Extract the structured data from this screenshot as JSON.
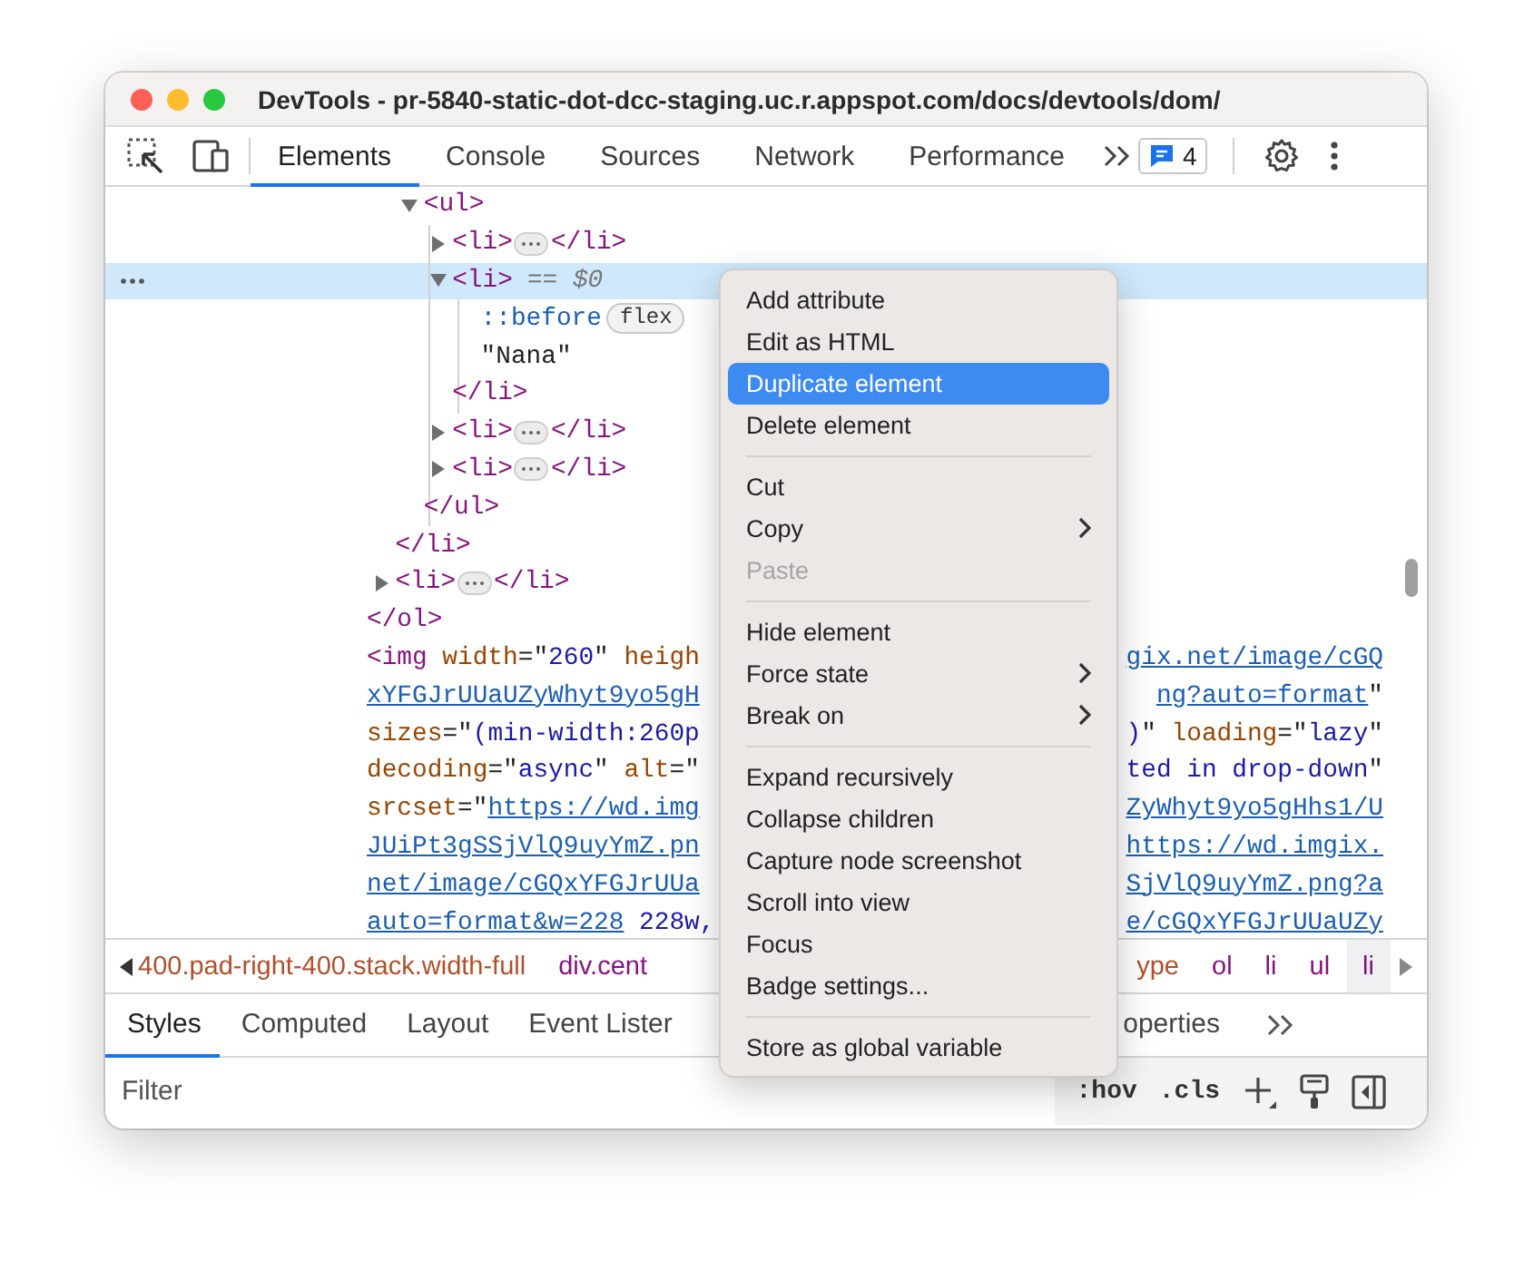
{
  "window": {
    "title": "DevTools - pr-5840-static-dot-dcc-staging.uc.r.appspot.com/docs/devtools/dom/"
  },
  "toolbar": {
    "tabs": [
      {
        "label": "Elements",
        "selected": true
      },
      {
        "label": "Console",
        "selected": false
      },
      {
        "label": "Sources",
        "selected": false
      },
      {
        "label": "Network",
        "selected": false
      },
      {
        "label": "Performance",
        "selected": false
      }
    ],
    "messages_count": "4"
  },
  "dom_tree": [
    {
      "kind": "element",
      "close": "</ol>",
      "children": [
        {
          "kind": "element",
          "close": "</li>",
          "children": [
            {
              "kind": "element",
              "open": "<ul>",
              "expanded": true,
              "selected": false,
              "close": "</ul>",
              "children": [
                {
                  "kind": "element",
                  "open": "<li>",
                  "expanded": false,
                  "selected": false,
                  "close": "</li>"
                },
                {
                  "kind": "element",
                  "open": "<li>",
                  "expanded": true,
                  "selected": true,
                  "reference": "== $0",
                  "close": "</li>",
                  "children": [
                    {
                      "kind": "pseudo",
                      "text": "::before",
                      "badge": "flex"
                    },
                    {
                      "kind": "text",
                      "text": "\"Nana\""
                    }
                  ]
                },
                {
                  "kind": "element",
                  "open": "<li>",
                  "expanded": false,
                  "selected": false,
                  "close": "</li>"
                },
                {
                  "kind": "element",
                  "open": "<li>",
                  "expanded": false,
                  "selected": false,
                  "close": "</li>"
                }
              ]
            }
          ]
        },
        {
          "kind": "element",
          "open": "<li>",
          "expanded": false,
          "selected": false,
          "close": "</li>"
        }
      ]
    },
    {
      "kind": "wrapped",
      "lines": [
        {
          "left": [
            {
              "kind": "tag",
              "text": "<img"
            },
            {
              "kind": "attr",
              "text": " width"
            },
            {
              "kind": "plain",
              "text": "=\""
            },
            {
              "kind": "value",
              "text": "260"
            },
            {
              "kind": "plain",
              "text": "\""
            },
            {
              "kind": "attr",
              "text": " heigh"
            }
          ],
          "right": [
            {
              "kind": "link",
              "text": "gix.net/image/cGQ"
            }
          ]
        },
        {
          "left": [
            {
              "kind": "link",
              "text": "xYFGJrUUaUZyWhyt9yo5gH"
            }
          ],
          "right": [
            {
              "kind": "link",
              "text": "ng?auto=format"
            },
            {
              "kind": "plain",
              "text": "\""
            }
          ]
        },
        {
          "left": [
            {
              "kind": "attr",
              "text": "sizes"
            },
            {
              "kind": "plain",
              "text": "=\""
            },
            {
              "kind": "value",
              "text": "(min-width:260p"
            }
          ],
          "right": [
            {
              "kind": "value",
              "text": ")"
            },
            {
              "kind": "plain",
              "text": "\""
            },
            {
              "kind": "attr",
              "text": " loading"
            },
            {
              "kind": "plain",
              "text": "=\""
            },
            {
              "kind": "value",
              "text": "lazy"
            },
            {
              "kind": "plain",
              "text": "\""
            }
          ]
        },
        {
          "left": [
            {
              "kind": "attr",
              "text": "decoding"
            },
            {
              "kind": "plain",
              "text": "=\""
            },
            {
              "kind": "value",
              "text": "async"
            },
            {
              "kind": "plain",
              "text": "\""
            },
            {
              "kind": "attr",
              "text": " alt"
            },
            {
              "kind": "plain",
              "text": "=\""
            }
          ],
          "right": [
            {
              "kind": "value",
              "text": "ted in drop-down"
            },
            {
              "kind": "plain",
              "text": "\""
            }
          ]
        },
        {
          "left": [
            {
              "kind": "attr",
              "text": "srcset"
            },
            {
              "kind": "plain",
              "text": "=\""
            },
            {
              "kind": "link",
              "text": "https://wd.img"
            }
          ],
          "right": [
            {
              "kind": "link",
              "text": "ZyWhyt9yo5gHhs1/U"
            }
          ]
        },
        {
          "left": [
            {
              "kind": "link",
              "text": "JUiPt3gSSjVlQ9uyYmZ.pn"
            }
          ],
          "right": [
            {
              "kind": "link",
              "text": "https://wd.imgix."
            }
          ]
        },
        {
          "left": [
            {
              "kind": "link",
              "text": "net/image/cGQxYFGJrUUa"
            }
          ],
          "right": [
            {
              "kind": "link",
              "text": "SjVlQ9uyYmZ.png?a"
            }
          ]
        },
        {
          "left": [
            {
              "kind": "link",
              "text": "auto=format&w=228"
            },
            {
              "kind": "value",
              "text": " 228w,"
            }
          ],
          "right": [
            {
              "kind": "link",
              "text": "e/cGQxYFGJrUUaUZy"
            }
          ]
        }
      ]
    }
  ],
  "breadcrumbs": {
    "left": [
      {
        "text": "400.pad-right-400.stack.width-full",
        "kind": "class",
        "selected": false
      },
      {
        "text": "div.cent",
        "kind": "tag",
        "selected": false
      }
    ],
    "right": [
      {
        "text": "ype",
        "kind": "class",
        "selected": false
      },
      {
        "text": "ol",
        "kind": "tag",
        "selected": false
      },
      {
        "text": "li",
        "kind": "tag",
        "selected": false
      },
      {
        "text": "ul",
        "kind": "tag",
        "selected": false
      },
      {
        "text": "li",
        "kind": "tag",
        "selected": true
      }
    ]
  },
  "styles_pane": {
    "tabs_left": [
      {
        "label": "Styles",
        "selected": true
      },
      {
        "label": "Computed",
        "selected": false
      },
      {
        "label": "Layout",
        "selected": false
      },
      {
        "label": "Event Lister",
        "selected": false
      }
    ],
    "tabs_right": [
      {
        "label": "operties",
        "selected": false
      }
    ],
    "filter": {
      "placeholder": "Filter"
    },
    "toggles": [
      ":hov",
      ".cls"
    ]
  },
  "context_menu": {
    "groups": [
      [
        {
          "label": "Add attribute",
          "selected": false,
          "disabled": false,
          "submenu": false
        },
        {
          "label": "Edit as HTML",
          "selected": false,
          "disabled": false,
          "submenu": false
        },
        {
          "label": "Duplicate element",
          "selected": true,
          "disabled": false,
          "submenu": false
        },
        {
          "label": "Delete element",
          "selected": false,
          "disabled": false,
          "submenu": false
        }
      ],
      [
        {
          "label": "Cut",
          "selected": false,
          "disabled": false,
          "submenu": false
        },
        {
          "label": "Copy",
          "selected": false,
          "disabled": false,
          "submenu": true
        },
        {
          "label": "Paste",
          "selected": false,
          "disabled": true,
          "submenu": false
        }
      ],
      [
        {
          "label": "Hide element",
          "selected": false,
          "disabled": false,
          "submenu": false
        },
        {
          "label": "Force state",
          "selected": false,
          "disabled": false,
          "submenu": true
        },
        {
          "label": "Break on",
          "selected": false,
          "disabled": false,
          "submenu": true
        }
      ],
      [
        {
          "label": "Expand recursively",
          "selected": false,
          "disabled": false,
          "submenu": false
        },
        {
          "label": "Collapse children",
          "selected": false,
          "disabled": false,
          "submenu": false
        },
        {
          "label": "Capture node screenshot",
          "selected": false,
          "disabled": false,
          "submenu": false
        },
        {
          "label": "Scroll into view",
          "selected": false,
          "disabled": false,
          "submenu": false
        },
        {
          "label": "Focus",
          "selected": false,
          "disabled": false,
          "submenu": false
        },
        {
          "label": "Badge settings...",
          "selected": false,
          "disabled": false,
          "submenu": false
        }
      ],
      [
        {
          "label": "Store as global variable",
          "selected": false,
          "disabled": false,
          "submenu": false
        }
      ]
    ]
  }
}
